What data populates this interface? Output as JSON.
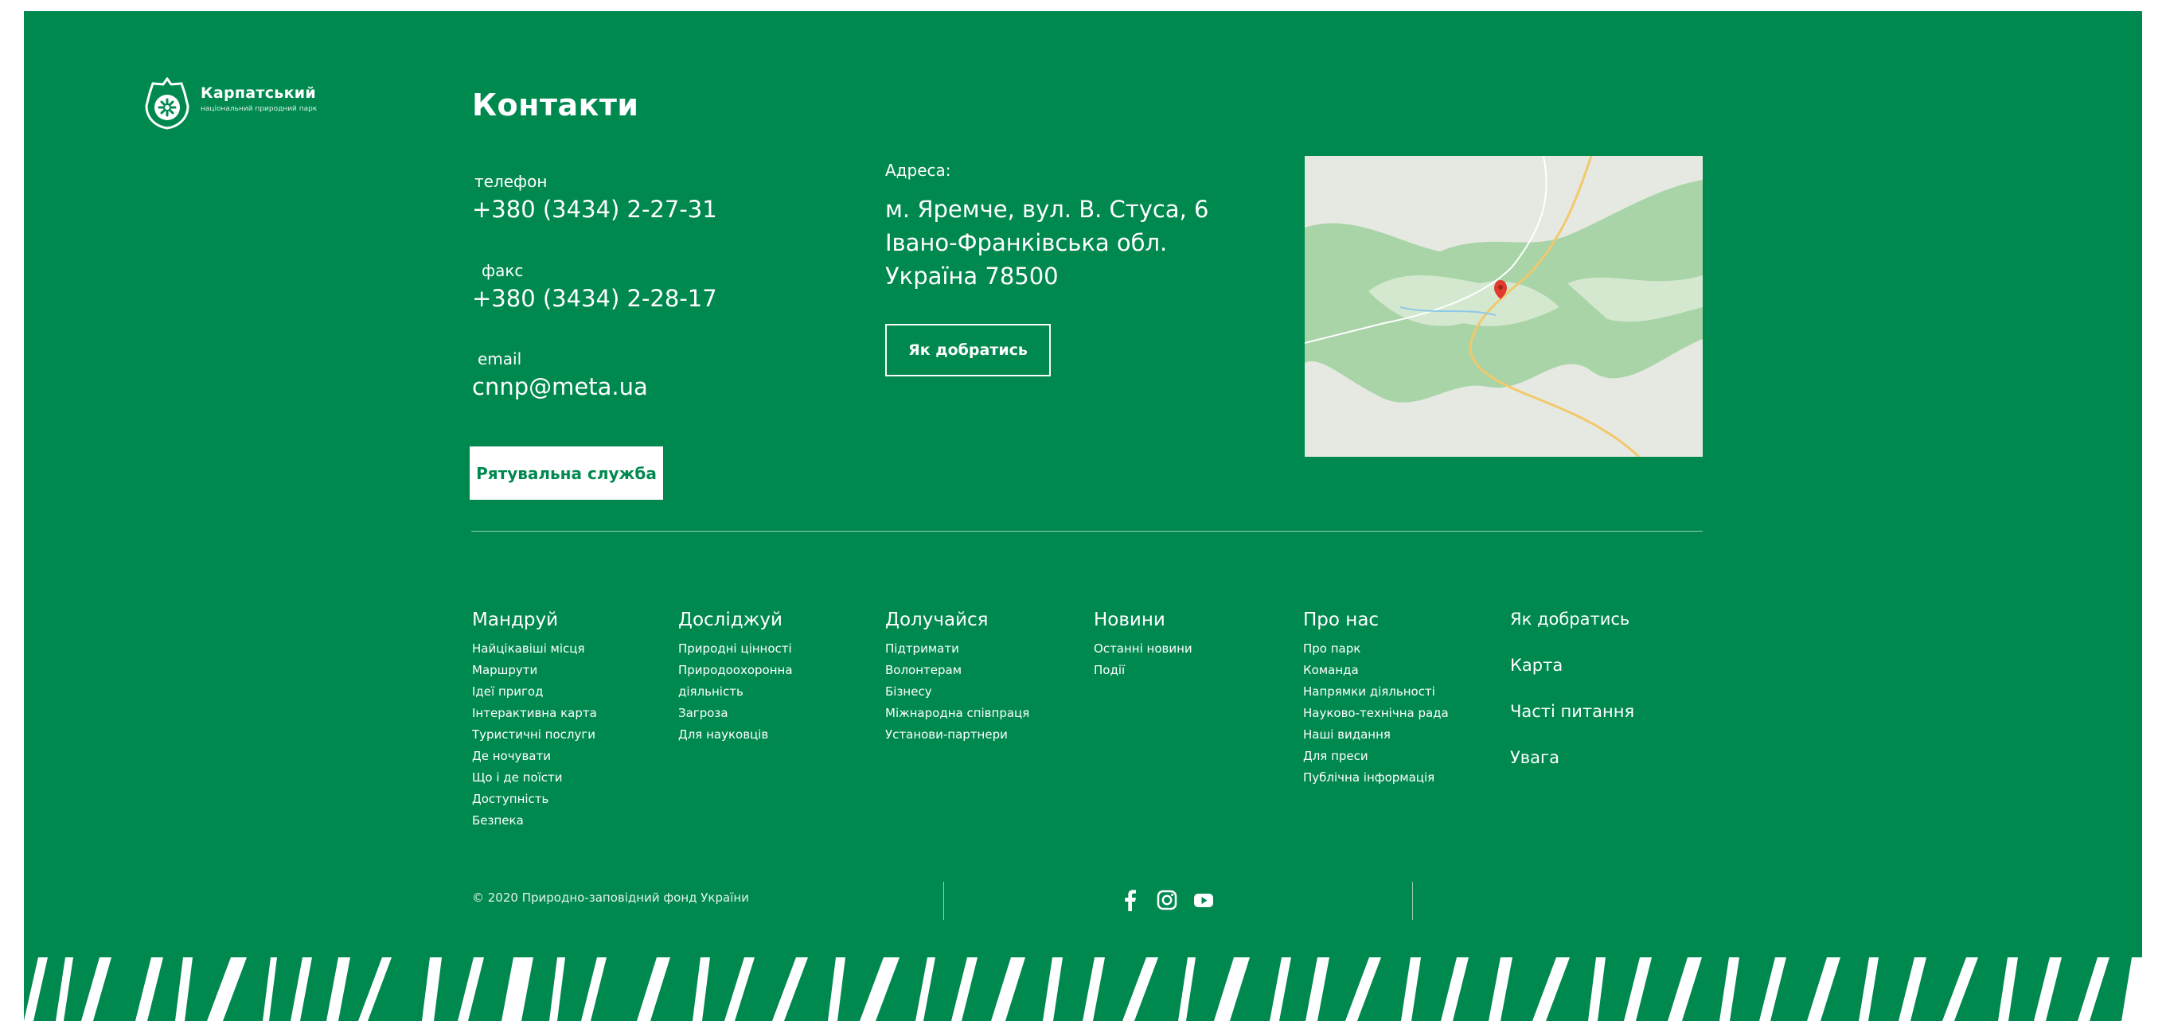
{
  "brand": {
    "name": "Карпатський",
    "subtitle": "національний природний парк"
  },
  "contacts": {
    "title": "Контакти",
    "phone_label": "телефон",
    "phone": "+380 (3434) 2-27-31",
    "fax_label": "факс",
    "fax": "+380 (3434) 2-28-17",
    "email_label": "email",
    "email": "cnnp@meta.ua",
    "rescue_button": "Рятувальна служба",
    "address_label": "Адреса:",
    "address_line1": "м. Яремче, вул. В. Стуса, 6",
    "address_line2": "Івано-Франківська обл.",
    "address_line3": "Україна 78500",
    "directions_button": "Як добратись"
  },
  "nav": {
    "columns": [
      {
        "heading": "Мандруй",
        "items": [
          "Найцікавіші місця",
          "Маршрути",
          "Ідеї пригод",
          "Інтерактивна карта",
          "Туристичні послуги",
          "Де ночувати",
          "Що і де поїсти",
          "Доступність",
          "Безпека"
        ]
      },
      {
        "heading": "Досліджуй",
        "items": [
          "Природні цінності",
          "Природоохоронна",
          "діяльність",
          "Загроза",
          "Для науковців"
        ]
      },
      {
        "heading": "Долучайся",
        "items": [
          "Підтримати",
          "Волонтерам",
          "Бізнесу",
          "Міжнародна співпраця",
          "Установи-партнери"
        ]
      },
      {
        "heading": "Новини",
        "items": [
          "Останні новини",
          "Події"
        ]
      },
      {
        "heading": "Про нас",
        "items": [
          "Про парк",
          "Команда",
          "Напрямки діяльності",
          "Науково-технічна рада",
          "Наші видання",
          "Для преси",
          "Публічна інформація"
        ]
      }
    ],
    "quick_links": [
      "Як добратись",
      "Карта",
      "Часті питання",
      "Увага"
    ]
  },
  "copyright": "© 2020 Природно-заповідний фонд України",
  "social": {
    "icons": [
      "facebook-icon",
      "instagram-icon",
      "youtube-icon"
    ]
  },
  "colors": {
    "background": "#00894f",
    "text": "#ffffff"
  }
}
